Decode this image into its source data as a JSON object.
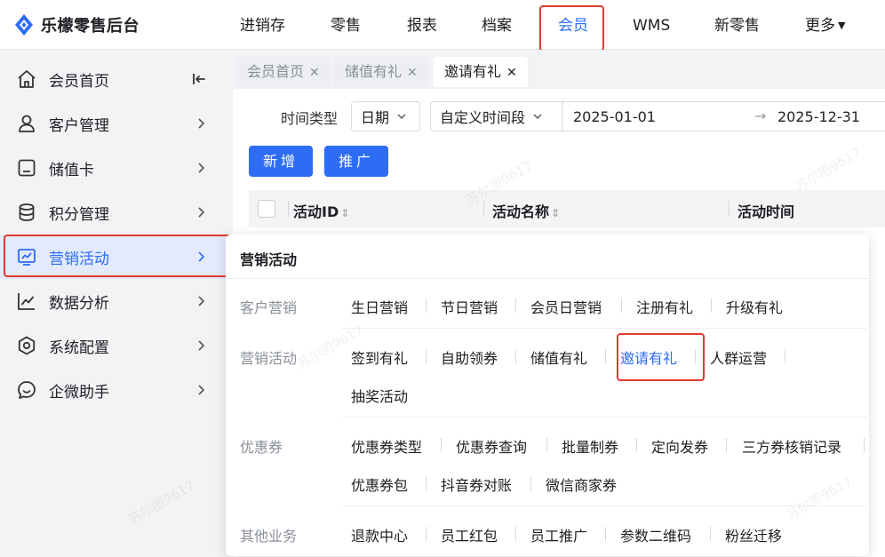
{
  "app": {
    "title": "乐檬零售后台"
  },
  "topnav": [
    "进销存",
    "零售",
    "报表",
    "档案",
    "会员",
    "WMS",
    "新零售",
    "更多"
  ],
  "sidebar": {
    "items": [
      {
        "label": "会员首页",
        "icon": "home-icon"
      },
      {
        "label": "客户管理",
        "icon": "user-icon"
      },
      {
        "label": "储值卡",
        "icon": "card-icon"
      },
      {
        "label": "积分管理",
        "icon": "database-icon"
      },
      {
        "label": "营销活动",
        "icon": "chart-screen-icon"
      },
      {
        "label": "数据分析",
        "icon": "line-chart-icon"
      },
      {
        "label": "系统配置",
        "icon": "settings-icon"
      },
      {
        "label": "企微助手",
        "icon": "chat-icon"
      }
    ],
    "active": "营销活动"
  },
  "tabs": [
    {
      "label": "会员首页",
      "close": "✕"
    },
    {
      "label": "储值有礼",
      "close": "✕"
    },
    {
      "label": "邀请有礼",
      "close": "✕"
    }
  ],
  "filter": {
    "time_type_label": "时间类型",
    "date_select": "日期",
    "period_select": "自定义时间段",
    "start_date": "2025-01-01",
    "range_arrow": "→",
    "end_date": "2025-12-31"
  },
  "buttons": {
    "add": "新增",
    "promote": "推广"
  },
  "table": {
    "headers": [
      "活动ID",
      "活动名称",
      "活动时间"
    ],
    "sort_glyph": "⇕"
  },
  "mega_menu": {
    "title": "营销活动",
    "sections": [
      {
        "label": "客户营销",
        "items": [
          "生日营销",
          "节日营销",
          "会员日营销",
          "注册有礼",
          "升级有礼"
        ]
      },
      {
        "label": "营销活动",
        "items": [
          "签到有礼",
          "自助领券",
          "储值有礼",
          "邀请有礼",
          "人群运营",
          "抽奖活动"
        ],
        "active": "邀请有礼"
      },
      {
        "label": "优惠券",
        "items": [
          "优惠券类型",
          "优惠券查询",
          "批量制券",
          "定向发券",
          "三方券核销记录",
          "优惠券包",
          "抖音券对账",
          "微信商家券"
        ]
      },
      {
        "label": "其他业务",
        "items": [
          "退款中心",
          "员工红包",
          "员工推广",
          "参数二维码",
          "粉丝迁移"
        ]
      }
    ]
  },
  "watermark": "苏尔图9617",
  "colors": {
    "accent": "#2d6cf5",
    "highlight": "#e23a2e",
    "active_bg": "#e3eafc"
  }
}
